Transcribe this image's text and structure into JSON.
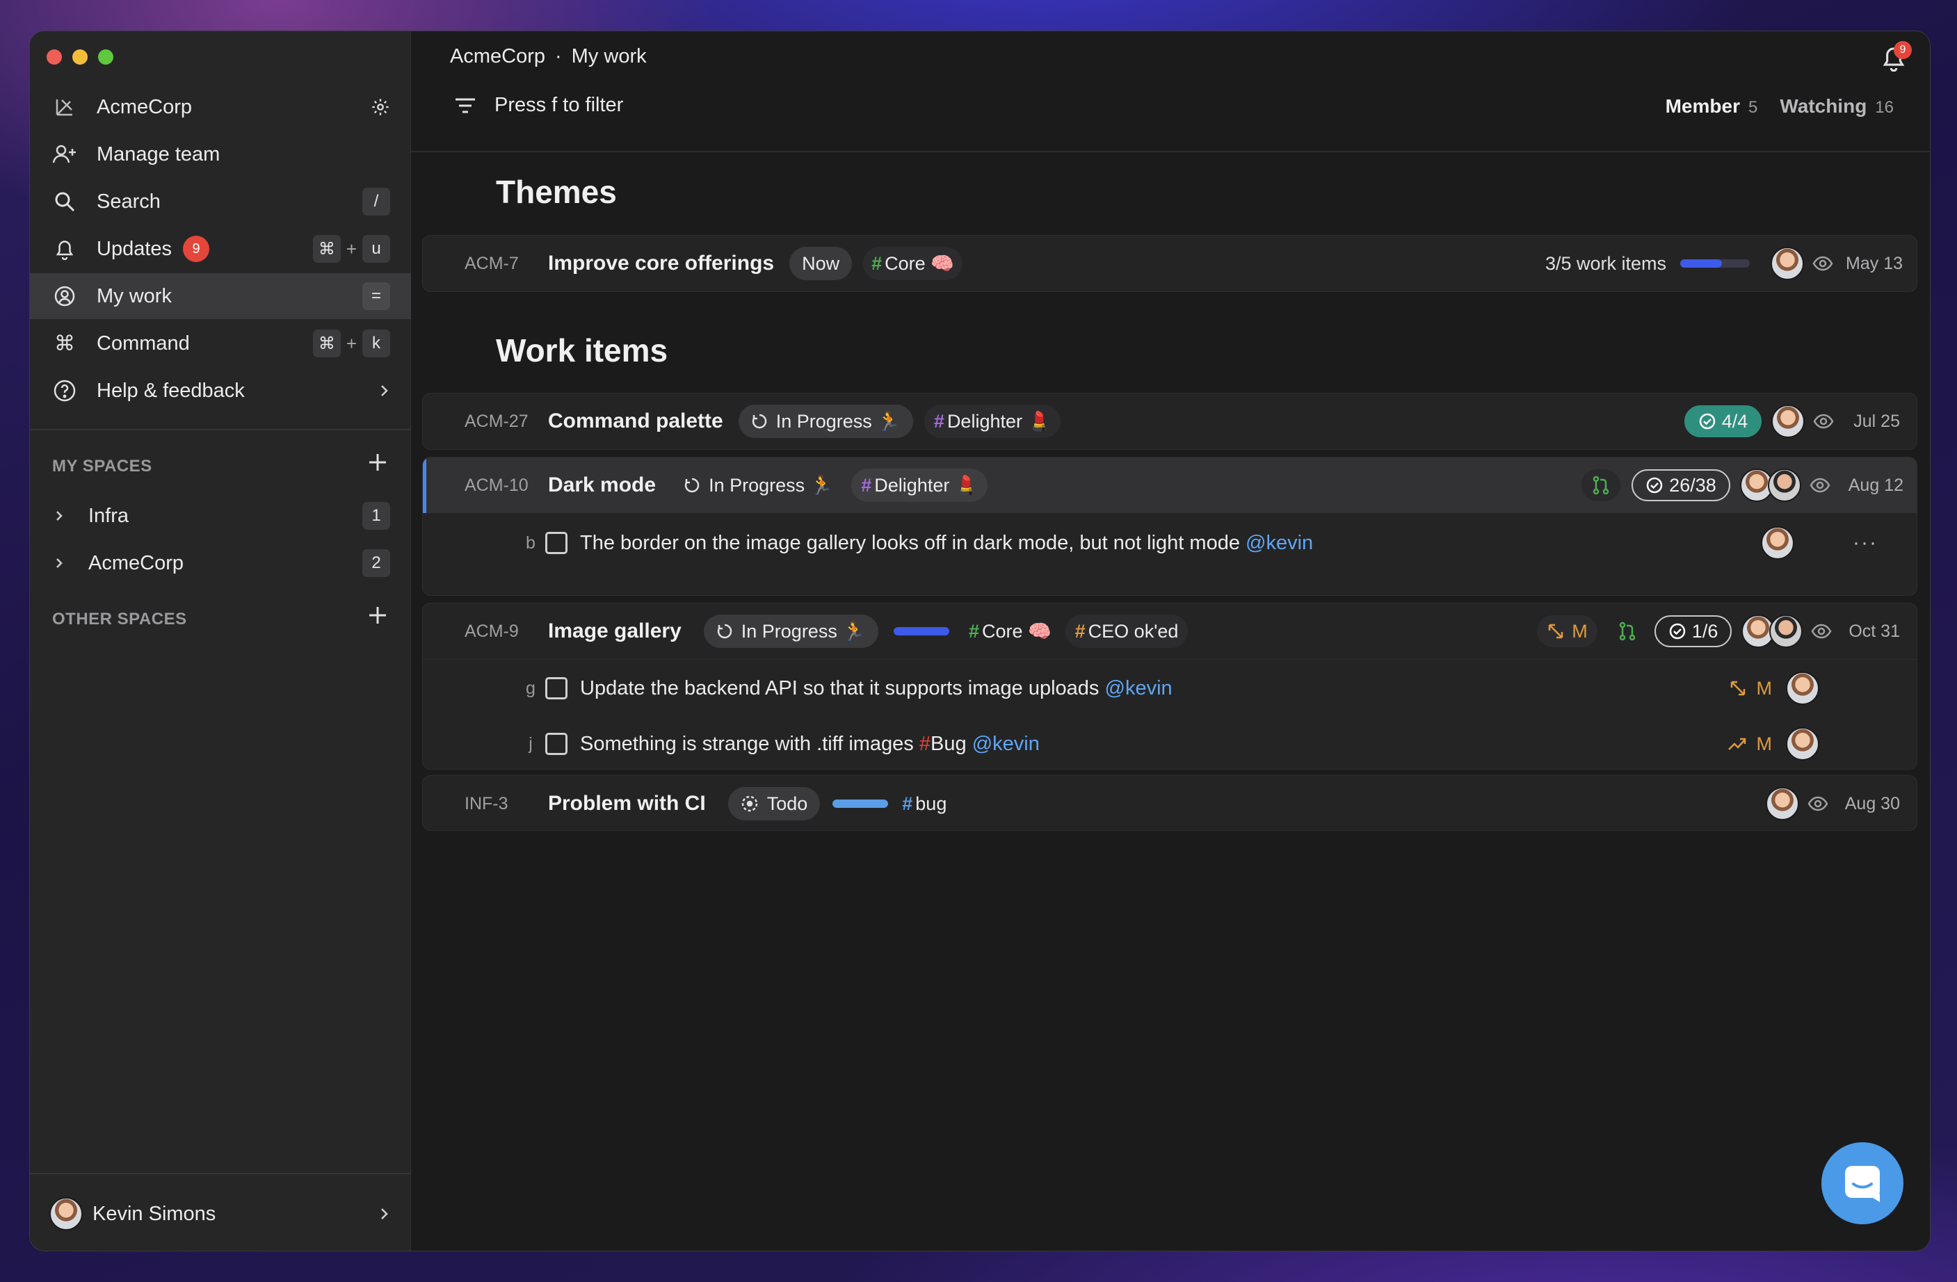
{
  "sidebar": {
    "org": "AcmeCorp",
    "items": [
      {
        "label": "Manage team"
      },
      {
        "label": "Search",
        "shortcut": "/"
      },
      {
        "label": "Updates",
        "badge": "9",
        "shortcut_mod": "⌘",
        "shortcut_plus": "+",
        "shortcut_key": "u"
      },
      {
        "label": "My work",
        "shortcut": "="
      },
      {
        "label": "Command",
        "shortcut_mod": "⌘",
        "shortcut_plus": "+",
        "shortcut_key": "k"
      },
      {
        "label": "Help & feedback"
      }
    ],
    "my_spaces_heading": "MY SPACES",
    "my_spaces": [
      {
        "label": "Infra",
        "count": "1"
      },
      {
        "label": "AcmeCorp",
        "count": "2"
      }
    ],
    "other_spaces_heading": "OTHER SPACES",
    "user_name": "Kevin Simons"
  },
  "header": {
    "breadcrumb_org": "AcmeCorp",
    "breadcrumb_sep": "·",
    "breadcrumb_page": "My work",
    "notification_count": "9",
    "filter_placeholder": "Press f to filter",
    "member_label": "Member",
    "member_count": "5",
    "watching_label": "Watching",
    "watching_count": "16"
  },
  "themes": {
    "heading": "Themes",
    "item": {
      "id": "ACM-7",
      "title": "Improve core offerings",
      "status": "Now",
      "tag": "Core 🧠",
      "progress_text": "3/5 work items",
      "progress_fraction": 0.6,
      "date": "May 13"
    }
  },
  "work_items": {
    "heading": "Work items",
    "items": [
      {
        "id": "ACM-27",
        "title": "Command palette",
        "status": "In Progress 🏃",
        "tag": "Delighter 💄",
        "checks": "4/4",
        "date": "Jul 25"
      },
      {
        "id": "ACM-10",
        "title": "Dark mode",
        "status": "In Progress 🏃",
        "tag": "Delighter 💄",
        "checks": "26/38",
        "date": "Aug 12",
        "subtasks": [
          {
            "key": "b",
            "text": "The border on the image gallery looks off in dark mode, but not light mode",
            "mention": "@kevin"
          }
        ]
      },
      {
        "id": "ACM-9",
        "title": "Image gallery",
        "status": "In Progress 🏃",
        "progress_fraction": 1.0,
        "tag": "Core 🧠",
        "tag2": "CEO ok'ed",
        "estimate": "M",
        "checks": "1/6",
        "date": "Oct 31",
        "subtasks": [
          {
            "key": "g",
            "text": "Update the backend API so that it supports image uploads",
            "mention": "@kevin",
            "estimate": "M"
          },
          {
            "key": "j",
            "text": "Something is strange with .tiff images",
            "tag": "Bug",
            "mention": "@kevin",
            "estimate": "M"
          }
        ]
      },
      {
        "id": "INF-3",
        "title": "Problem with CI",
        "status": "Todo",
        "progress_fraction": 1.0,
        "tag": "bug",
        "date": "Aug 30"
      }
    ]
  },
  "colors": {
    "accent": "#3d5be8",
    "badge": "#e5463b",
    "mention": "#5ea6f5",
    "check_done": "#2f8f7e",
    "core_hash": "#4caf50",
    "delighter_hash": "#a46bd9",
    "ceo_hash": "#e09a3a"
  }
}
